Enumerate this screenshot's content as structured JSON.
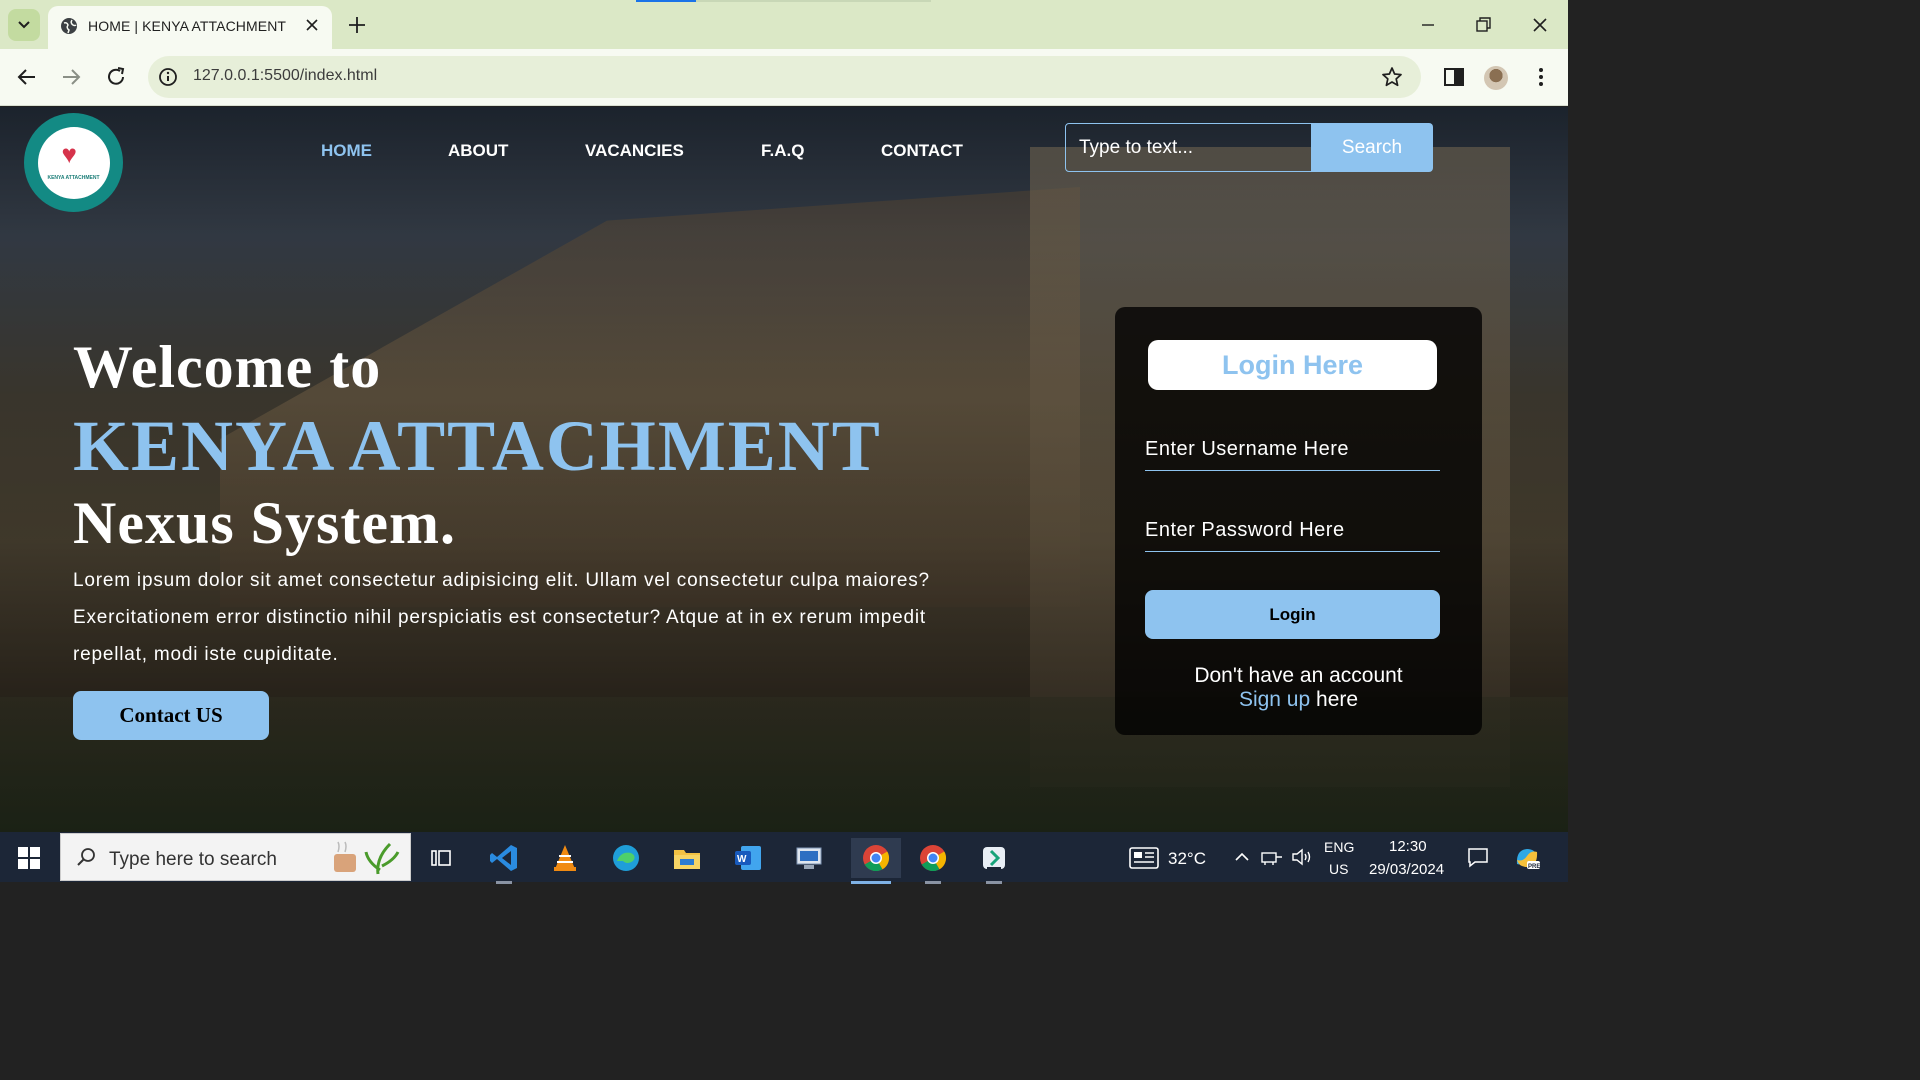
{
  "browser": {
    "tab_title": "HOME | KENYA ATTACHMENT",
    "url": "127.0.0.1:5500/index.html"
  },
  "site": {
    "logo_text": "KENYA ATTACHMENT",
    "nav": [
      "HOME",
      "ABOUT",
      "VACANCIES",
      "F.A.Q",
      "CONTACT"
    ],
    "search_placeholder": "Type to text...",
    "search_button": "Search"
  },
  "hero": {
    "line1": "Welcome to",
    "line2": "KENYA ATTACHMENT",
    "line3": "Nexus System.",
    "paragraph": "Lorem ipsum dolor sit amet consectetur adipisicing elit. Ullam vel consectetur culpa maiores? Exercitationem error distinctio nihil perspiciatis est consectetur? Atque at in ex rerum impedit repellat, modi iste cupiditate.",
    "contact_button": "Contact US"
  },
  "login": {
    "title": "Login Here",
    "username_placeholder": "Enter Username Here",
    "password_placeholder": "Enter Password Here",
    "button": "Login",
    "signup_prefix": "Don't have an account",
    "signup_link": "Sign up",
    "signup_suffix": "here"
  },
  "taskbar": {
    "search_placeholder": "Type here to search",
    "weather": "32°C",
    "lang_top": "ENG",
    "lang_bottom": "US",
    "time": "12:30",
    "date": "29/03/2024"
  },
  "colors": {
    "accent": "#8ec3ef",
    "logo_teal": "#138a84",
    "tabbar": "#dbe8c6"
  }
}
